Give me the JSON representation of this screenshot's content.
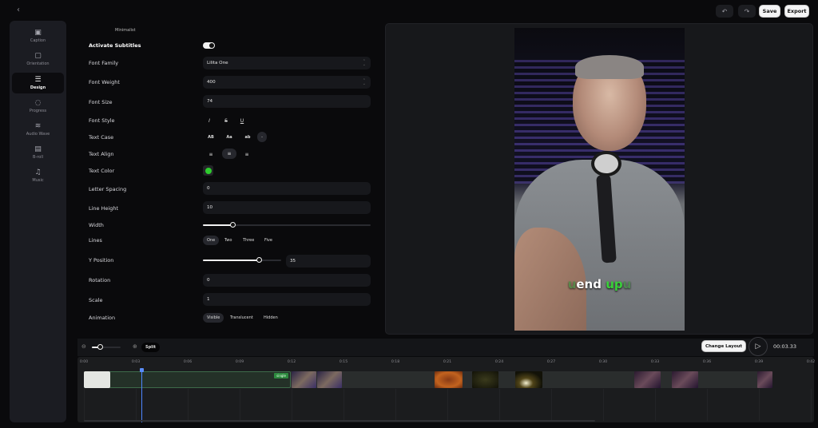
{
  "topbar": {
    "back_icon": "chevron-left",
    "undo_icon": "undo",
    "redo_icon": "redo",
    "save_label": "Save",
    "export_label": "Export"
  },
  "sidebar": {
    "items": [
      {
        "label": "Caption",
        "icon": "caption-icon",
        "glyph": "▣",
        "active": false
      },
      {
        "label": "Orientation",
        "icon": "orientation-icon",
        "glyph": "▢",
        "active": false
      },
      {
        "label": "Design",
        "icon": "sliders-icon",
        "glyph": "☰",
        "active": true
      },
      {
        "label": "Progress",
        "icon": "progress-icon",
        "glyph": "◌",
        "active": false
      },
      {
        "label": "Audio Wave",
        "icon": "audio-wave-icon",
        "glyph": "≋",
        "active": false
      },
      {
        "label": "B-roll",
        "icon": "film-icon",
        "glyph": "▤",
        "active": false
      },
      {
        "label": "Music",
        "icon": "music-icon",
        "glyph": "♫",
        "active": false
      }
    ]
  },
  "settings": {
    "preset_name": "Minimalist",
    "activate_subtitles": {
      "label": "Activate Subtitles",
      "value": true
    },
    "font_family": {
      "label": "Font Family",
      "value": "Lilita One"
    },
    "font_weight": {
      "label": "Font Weight",
      "value": "400"
    },
    "font_size": {
      "label": "Font Size",
      "value": "74"
    },
    "font_style": {
      "label": "Font Style",
      "options": [
        "I",
        "S",
        "U"
      ]
    },
    "text_case": {
      "label": "Text Case",
      "options": [
        "AB",
        "Aa",
        "ab",
        "-"
      ]
    },
    "text_align": {
      "label": "Text Align",
      "options": [
        "left",
        "center",
        "right"
      ],
      "selected": "center"
    },
    "text_color": {
      "label": "Text Color",
      "value": "#2ecc2e"
    },
    "letter_spacing": {
      "label": "Letter Spacing",
      "value": "0"
    },
    "line_height": {
      "label": "Line Height",
      "value": "10"
    },
    "width": {
      "label": "Width",
      "fraction": 0.18
    },
    "lines": {
      "label": "Lines",
      "options": [
        "One",
        "Two",
        "Three",
        "Five"
      ],
      "selected": "One"
    },
    "y_position": {
      "label": "Y Position",
      "value": "35",
      "fraction": 0.72
    },
    "rotation": {
      "label": "Rotation",
      "value": "0"
    },
    "scale": {
      "label": "Scale",
      "value": "1"
    },
    "animation": {
      "label": "Animation",
      "options": [
        "Visible",
        "Translucent",
        "Hidden"
      ],
      "selected": "Visible"
    }
  },
  "preview": {
    "caption_words": [
      {
        "text": "u",
        "style": "dim"
      },
      {
        "text": "end ",
        "style": "white"
      },
      {
        "text": "up",
        "style": "green"
      },
      {
        "text": "u",
        "style": "dim"
      }
    ]
  },
  "timeline": {
    "zoom_out_icon": "zoom-out",
    "zoom_in_icon": "zoom-in",
    "zoom_fraction": 0.3,
    "split_label": "Split",
    "change_layout_label": "Change Layout",
    "play_icon": "play",
    "current_time": "00:03.33",
    "ticks": [
      "0:00",
      "0:03",
      "0:06",
      "0:09",
      "0:12",
      "0:15",
      "0:18",
      "0:21",
      "0:24",
      "0:27",
      "0:30",
      "0:33",
      "0:36",
      "0:39",
      "0:42"
    ],
    "segment_badge": "single",
    "playhead_time_s": 3.33
  }
}
